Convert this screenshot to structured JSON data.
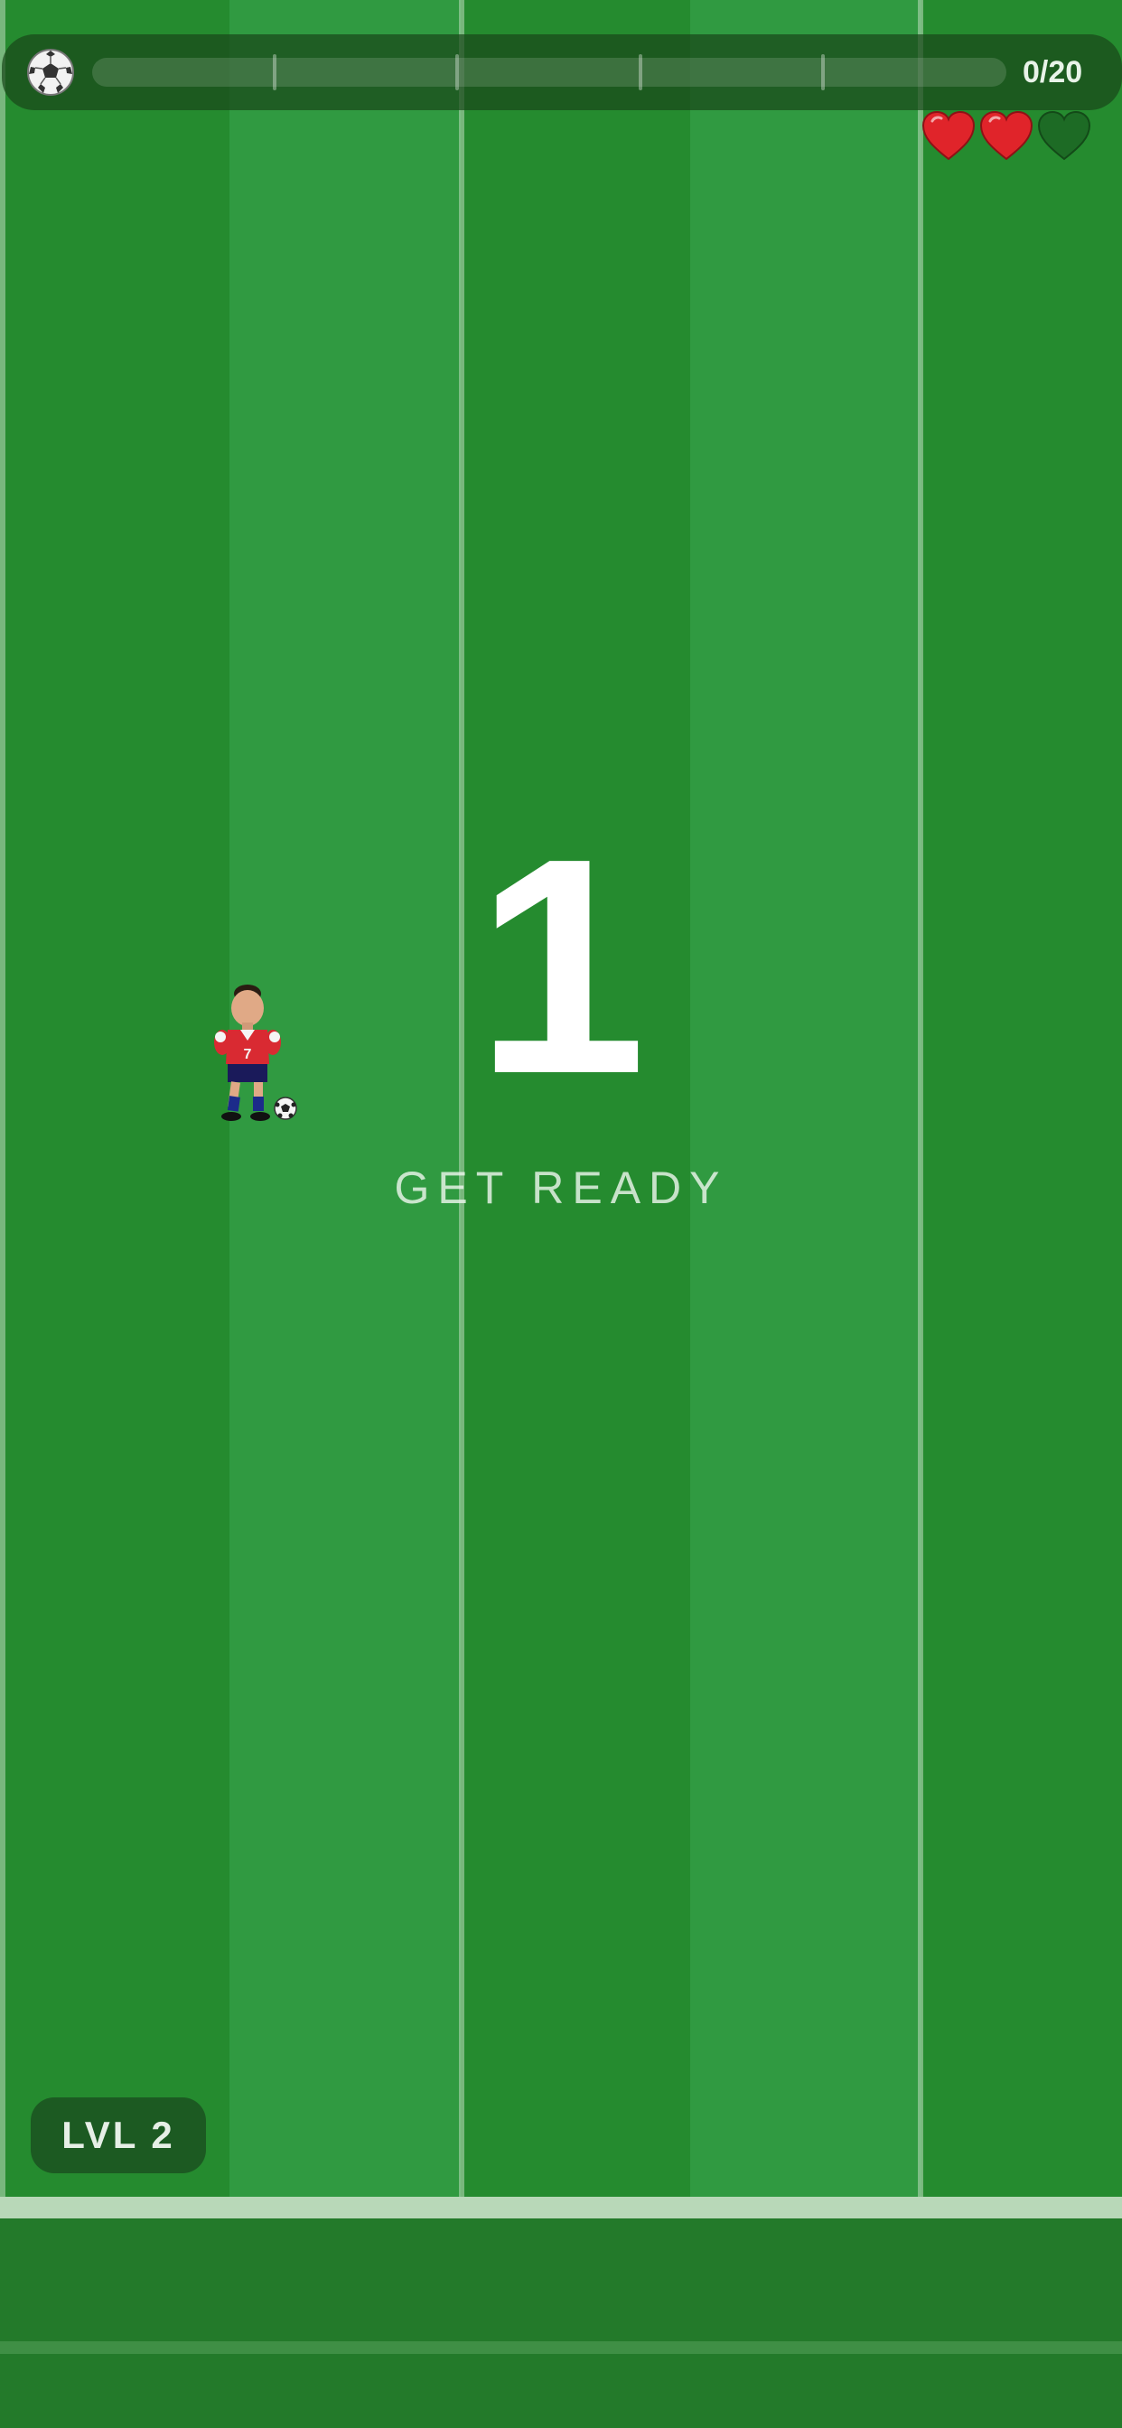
{
  "hud": {
    "progress_label": "0/20",
    "goals_scored": 0,
    "goals_total": 20,
    "progress_fraction": 0,
    "progress_milestones": 5,
    "ball_icon": "soccer-ball-icon"
  },
  "lives": {
    "max": 3,
    "remaining": 2,
    "full_color": "#e0242a",
    "empty_color": "#1d6b25",
    "icon": "heart-icon"
  },
  "countdown": {
    "number": "1",
    "message": "GET READY"
  },
  "player": {
    "shirt_number": "7",
    "shirt_color": "#d92a32",
    "shorts_color": "#1a1a5a"
  },
  "level": {
    "label": "LVL 2"
  },
  "colors": {
    "pitch_dark": "#258b2f",
    "pitch_light": "#309a41",
    "accent": "#6fd36f"
  }
}
